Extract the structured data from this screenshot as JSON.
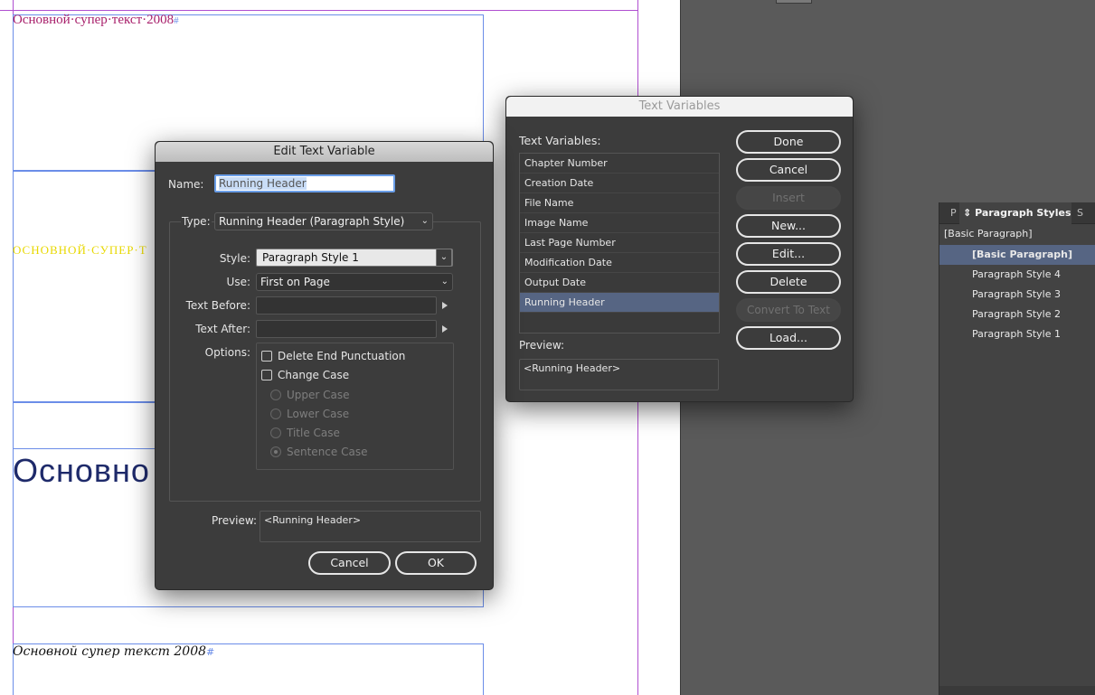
{
  "document": {
    "sample_serif": "Основной·супер·текст·2008",
    "sample_caps": "ОСНОВНОЙ·СУПЕР·Т",
    "sample_large": "Основно",
    "sample_script": "Основной супер текст 2008",
    "pilcrow": "#",
    "colors": {
      "magenta": "#a8206b",
      "yellow": "#e8d800",
      "navy": "#1e2a6a",
      "frame_blue": "#6b8de8",
      "margin_purple": "#b04fd0"
    }
  },
  "edit_dialog": {
    "title": "Edit Text Variable",
    "name_label": "Name:",
    "name_value": "Running Header",
    "type_label": "Type:",
    "type_value": "Running Header (Paragraph Style)",
    "style_label": "Style:",
    "style_value": "Paragraph Style 1",
    "use_label": "Use:",
    "use_value": "First on Page",
    "text_before_label": "Text Before:",
    "text_after_label": "Text After:",
    "options_label": "Options:",
    "delete_punct_label": "Delete End Punctuation",
    "change_case_label": "Change Case",
    "upper_case_label": "Upper Case",
    "lower_case_label": "Lower Case",
    "title_case_label": "Title Case",
    "sentence_case_label": "Sentence Case",
    "preview_label": "Preview:",
    "preview_value": "<Running Header>",
    "cancel_label": "Cancel",
    "ok_label": "OK"
  },
  "text_variables_dialog": {
    "title": "Text Variables",
    "list_label": "Text Variables:",
    "items": [
      "Chapter Number",
      "Creation Date",
      "File Name",
      "Image Name",
      "Last Page Number",
      "Modification Date",
      "Output Date",
      "Running Header"
    ],
    "selected_item": "Running Header",
    "preview_label": "Preview:",
    "preview_value": "<Running Header>",
    "buttons": {
      "done": "Done",
      "cancel": "Cancel",
      "insert": "Insert",
      "new": "New...",
      "edit": "Edit...",
      "delete": "Delete",
      "convert": "Convert To Text",
      "load": "Load..."
    }
  },
  "paragraph_styles_panel": {
    "tab_left": "P",
    "tab_active": "Paragraph Styles",
    "tab_right": "S",
    "current_style": "[Basic Paragraph]",
    "items": [
      "[Basic Paragraph]",
      "Paragraph Style 4",
      "Paragraph Style 3",
      "Paragraph Style 2",
      "Paragraph Style 1"
    ],
    "selected_item": "[Basic Paragraph]"
  }
}
